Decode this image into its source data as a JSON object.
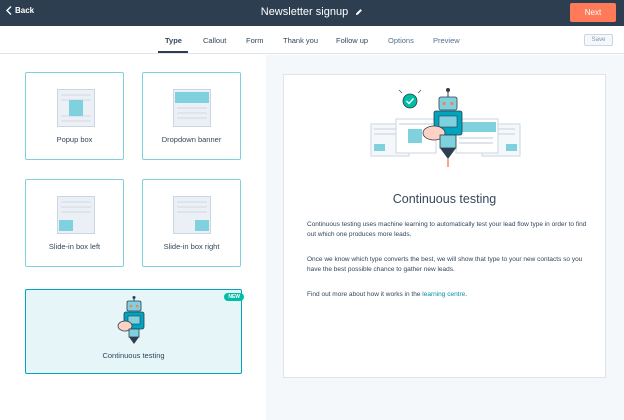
{
  "header": {
    "back_label": "Back",
    "title": "Newsletter signup",
    "next_label": "Next"
  },
  "tabs": [
    {
      "label": "Type"
    },
    {
      "label": "Callout"
    },
    {
      "label": "Form"
    },
    {
      "label": "Thank you"
    },
    {
      "label": "Follow up"
    },
    {
      "label": "Options"
    },
    {
      "label": "Preview"
    }
  ],
  "save_label": "Save",
  "types": [
    {
      "label": "Popup box"
    },
    {
      "label": "Dropdown banner"
    },
    {
      "label": "Slide-in box left"
    },
    {
      "label": "Slide-in box right"
    },
    {
      "label": "Continuous testing",
      "badge": "NEW"
    }
  ],
  "info": {
    "heading": "Continuous testing",
    "para1": "Continuous testing uses machine learning to automatically test your lead flow type in order to find out which one produces more leads.",
    "para2": "Once we know which type converts the best, we will show that type to your new contacts so you have the best possible chance to gather new leads.",
    "para3_prefix": "Find out more about how it works in the ",
    "para3_link": "learning centre",
    "para3_suffix": "."
  },
  "colors": {
    "header_bg": "#2d3e50",
    "accent_orange": "#ff7a59",
    "accent_teal": "#00a4bd",
    "thumb_teal": "#7fd1de",
    "badge_green": "#00bda5",
    "link": "#0091ae"
  }
}
